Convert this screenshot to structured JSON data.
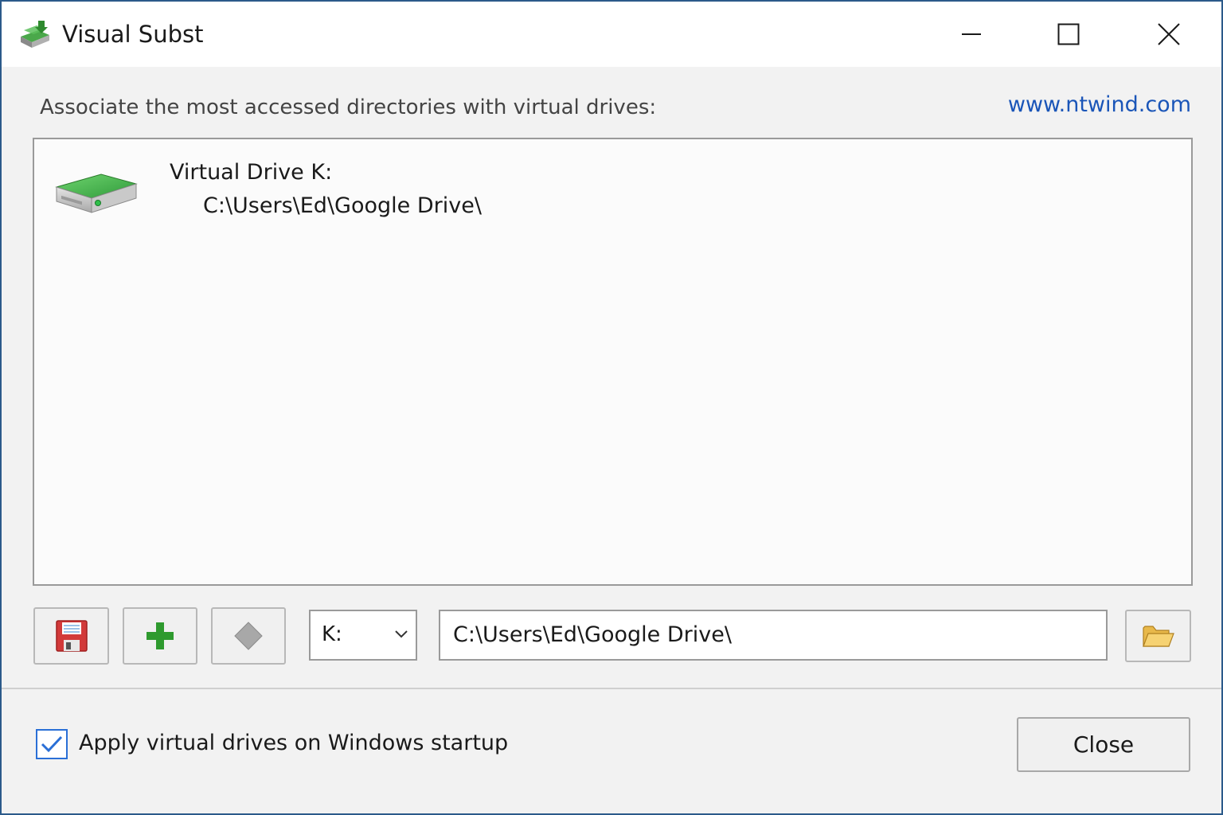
{
  "window": {
    "title": "Visual Subst",
    "app_icon": "green-drive-icon",
    "controls": [
      "minimize-icon",
      "maximize-icon",
      "close-icon"
    ]
  },
  "main": {
    "hint": "Associate the most accessed directories with virtual drives:",
    "link_text": "www.ntwind.com"
  },
  "drive_list": {
    "items": [
      {
        "name": "Virtual Drive K:",
        "path": "C:\\Users\\Ed\\Google Drive\\",
        "icon": "hard-drive-icon"
      }
    ]
  },
  "toolbar": {
    "buttons": [
      "save-floppy-icon",
      "add-plus-icon",
      "remove-diamond-icon"
    ],
    "drive_letter": "K:",
    "path_value": "C:\\Users\\Ed\\Google Drive\\",
    "browse_icon": "folder-open-icon"
  },
  "footer": {
    "startup_label": "Apply virtual drives on Windows startup",
    "startup_checked": true,
    "close_label": "Close"
  },
  "colors": {
    "accent": "#2a6fd6",
    "link": "#1a55b8",
    "drive_green": "#3aa83a",
    "add_green": "#2e9a2e",
    "save_red": "#d23a3a",
    "window_border": "#2b5a8a"
  }
}
